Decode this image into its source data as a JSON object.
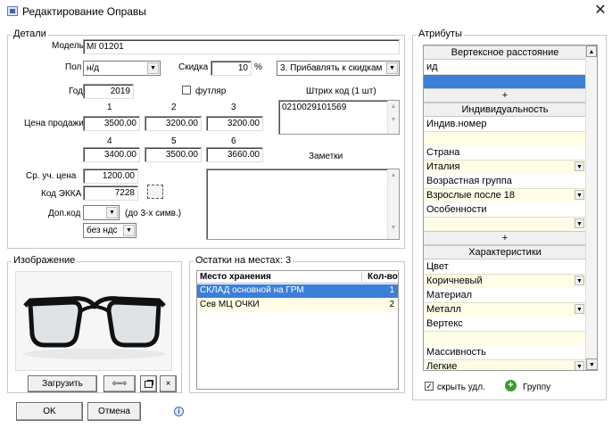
{
  "window": {
    "title": "Редактирование Оправы",
    "close": "✕"
  },
  "details": {
    "group_label": "Детали",
    "model_label": "Модель",
    "model_value": "MI 01201",
    "gender_label": "Пол",
    "gender_value": "н/д",
    "discount_label": "Скидка",
    "discount_value": "10",
    "discount_unit": "%",
    "discount_mode": "3. Прибавлять к скидкам",
    "year_label": "Год",
    "year_value": "2019",
    "case_label": "футляр",
    "case_checked": false,
    "barcode_label": "Штрих код (1 шт)",
    "barcode_value": "0210029101569",
    "price_label": "Цена продажи",
    "price_cols": [
      "1",
      "2",
      "3",
      "4",
      "5",
      "6"
    ],
    "prices": [
      "3500.00",
      "3200.00",
      "3200.00",
      "3400.00",
      "3500.00",
      "3660.00"
    ],
    "notes_label": "Заметки",
    "notes_value": "",
    "avg_price_label": "Ср. уч. цена",
    "avg_price_value": "1200.00",
    "ekka_label": "Код ЭККА",
    "ekka_value": "7228",
    "addcode_label": "Доп.код",
    "addcode_value": "",
    "addcode_hint": "(до 3-х симв.)",
    "vat_value": "без ндс"
  },
  "image": {
    "group_label": "Изображение",
    "load_button": "Загрузить",
    "prev_next": "⇦⇨",
    "copy_icon": "copy-icon",
    "delete": "×"
  },
  "stock": {
    "group_label": "Остатки на местах: 3",
    "columns": [
      "Место хранения",
      "Кол-во"
    ],
    "rows": [
      {
        "place": "СКЛАД основной на ГРМ",
        "qty": "1"
      },
      {
        "place": "Сев МЦ  ОЧКИ",
        "qty": "2"
      }
    ]
  },
  "attributes": {
    "group_label": "Атрибуты",
    "items": [
      {
        "kind": "head",
        "text": "Вертексное расстояние"
      },
      {
        "kind": "label",
        "text": "ид"
      },
      {
        "kind": "value",
        "text": "",
        "selected": true
      },
      {
        "kind": "head",
        "text": "+"
      },
      {
        "kind": "head",
        "text": "Индивидуальность"
      },
      {
        "kind": "label",
        "text": "Индив.номер"
      },
      {
        "kind": "value",
        "text": ""
      },
      {
        "kind": "label",
        "text": "Страна"
      },
      {
        "kind": "combo",
        "text": "Италия"
      },
      {
        "kind": "label",
        "text": "Возрастная группа"
      },
      {
        "kind": "combo",
        "text": "Взрослые после 18"
      },
      {
        "kind": "label",
        "text": "Особенности"
      },
      {
        "kind": "combo",
        "text": ""
      },
      {
        "kind": "head",
        "text": "+"
      },
      {
        "kind": "head",
        "text": "Характеристики"
      },
      {
        "kind": "label",
        "text": "Цвет"
      },
      {
        "kind": "combo",
        "text": "Коричневый"
      },
      {
        "kind": "label",
        "text": "Материал"
      },
      {
        "kind": "combo",
        "text": "Металл"
      },
      {
        "kind": "label",
        "text": "Вертекс"
      },
      {
        "kind": "value",
        "text": ""
      },
      {
        "kind": "label",
        "text": "Массивность"
      },
      {
        "kind": "combo",
        "text": "Легкие"
      }
    ],
    "hide_deleted_label": "скрыть удл.",
    "hide_deleted_checked": true,
    "group_button": "Группу"
  },
  "footer": {
    "ok": "OK",
    "cancel": "Отмена",
    "info_icon": "info-icon"
  },
  "colors": {
    "selection": "#3b7fd9",
    "value_bg": "#fffde6",
    "accent_green": "#3a9d2c"
  }
}
